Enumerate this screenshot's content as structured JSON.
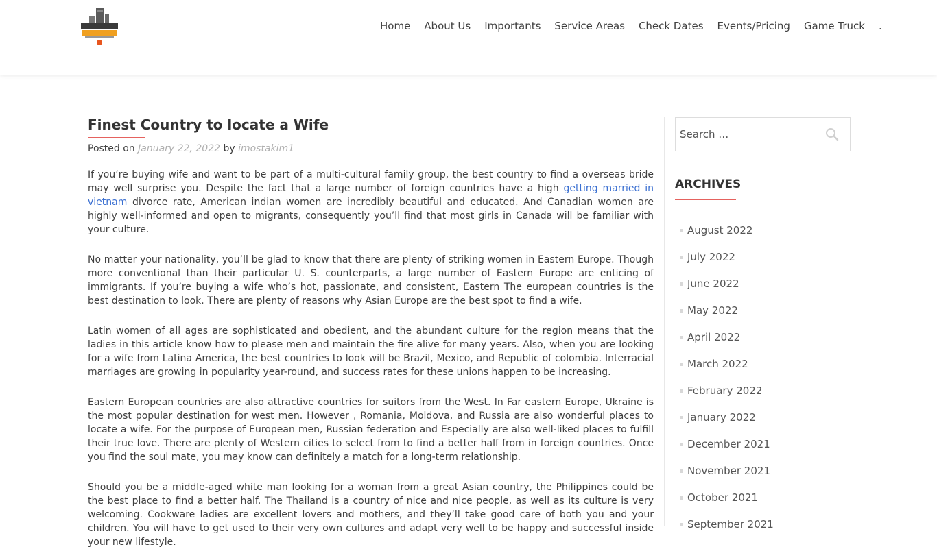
{
  "header": {
    "logo_icon": "gaming-unplugged-logo",
    "nav": [
      "Home",
      "About Us",
      "Importants",
      "Service Areas",
      "Check Dates",
      "Events/Pricing",
      "Game Truck",
      "."
    ]
  },
  "post": {
    "title": "Finest Country to locate a Wife",
    "posted_on_label": "Posted on",
    "date": "January 22, 2022",
    "by_label": "by",
    "author": "imostakim1",
    "p1_before": "If you’re buying wife and want to be part of a multi-cultural family group, the best country to find a overseas bride may well surprise you. Despite the fact that a large number of foreign countries have a high ",
    "p1_link": "getting married in vietnam",
    "p1_after": " divorce rate, American indian women are incredibly beautiful and educated. And Canadian women are highly well-informed and open to migrants, consequently you’ll find that most girls in Canada will be familiar with your culture.",
    "p2": "No matter your nationality, you’ll be glad to know that there are plenty of striking women in Eastern Europe. Though more conventional than their particular U. S. counterparts, a large number of Eastern Europe are enticing of immigrants. If you’re buying a wife who’s hot, passionate, and consistent, Eastern The european countries is the best destination to look. There are plenty of reasons why Asian Europe are the best spot to find a wife.",
    "p3": "Latin women of all ages are sophisticated and obedient, and the abundant culture for the region means that the ladies in this article know how to please men and maintain the fire alive for many years. Also, when you are looking for a wife from Latina America, the best countries to look will be Brazil, Mexico, and Republic of colombia. Interracial marriages are growing in popularity year-round, and success rates for these unions happen to be increasing.",
    "p4": "Eastern European countries are also attractive countries for suitors from the West. In Far eastern Europe, Ukraine is the most popular destination for west men. However , Romania, Moldova, and Russia are also wonderful places to locate a wife. For the purpose of European men, Russian federation and Especially are also well-liked places to fulfill their true love. There are plenty of Western cities to select from to find a better half from in foreign countries. Once you find the soul mate, you may know can definitely a match for a long-term relationship.",
    "p5": "Should you be a middle-aged white man looking for a woman from a great Asian country, the Philippines could be the best place to find a better half. The Thailand is a country of nice and nice people, as well as its culture is very welcoming. Cookware ladies are excellent lovers and mothers, and they’ll take good care of both you and your children. You will have to get used to their very own cultures and adapt very well to be happy and successful inside your new lifestyle."
  },
  "sidebar": {
    "search_placeholder": "Search …",
    "archives_title": "ARCHIVES",
    "archives": [
      "August 2022",
      "July 2022",
      "June 2022",
      "May 2022",
      "April 2022",
      "March 2022",
      "February 2022",
      "January 2022",
      "December 2021",
      "November 2021",
      "October 2021",
      "September 2021"
    ]
  },
  "colors": {
    "accent": "#e5625e",
    "link": "#3a6fd1",
    "muted": "#b0b0b0"
  }
}
